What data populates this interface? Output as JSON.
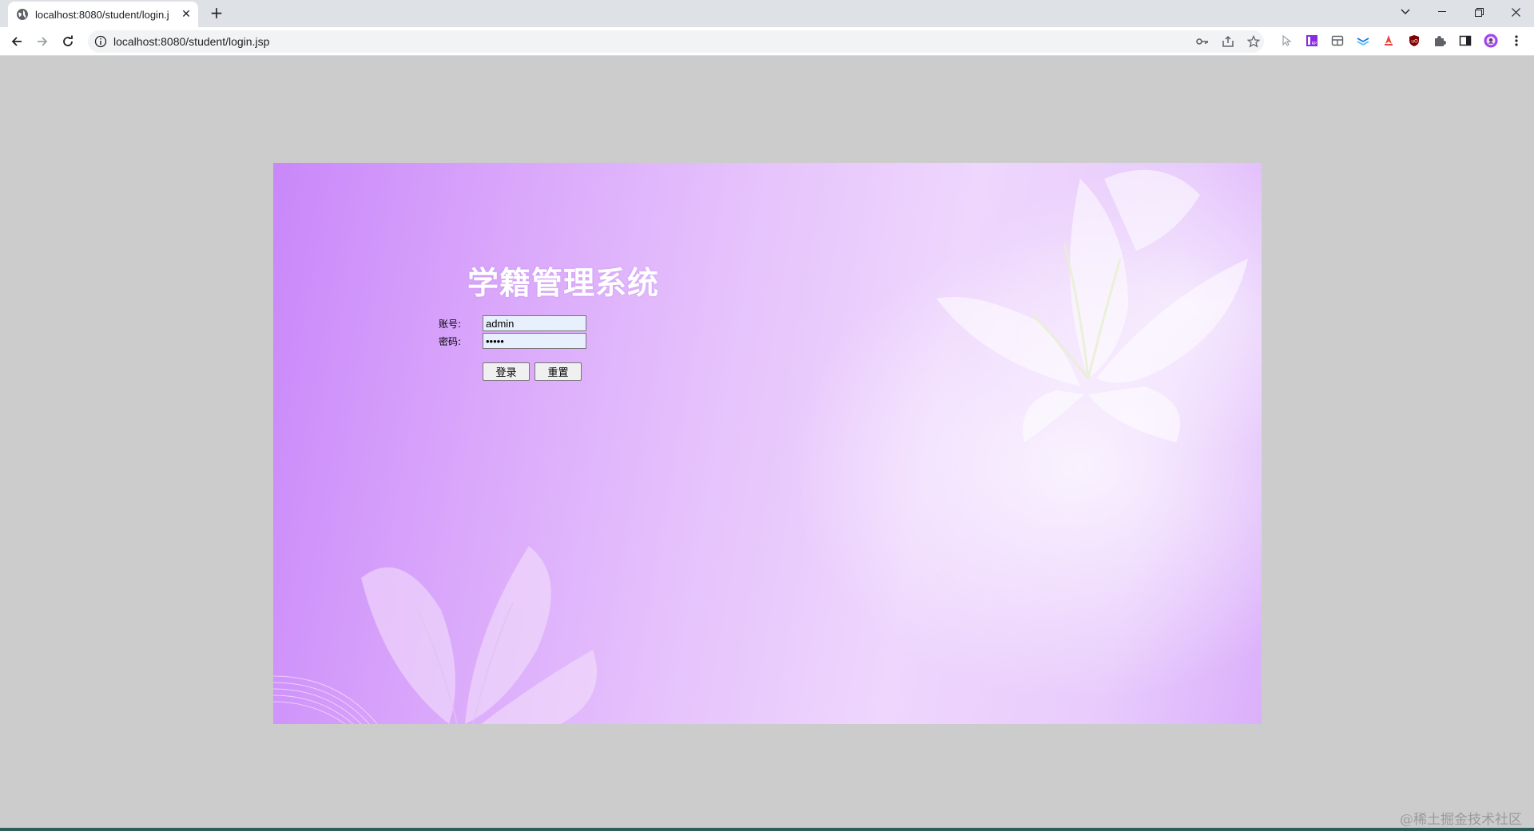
{
  "browser": {
    "tab": {
      "title": "localhost:8080/student/login.j",
      "close_glyph": "✕"
    },
    "new_tab_glyph": "+",
    "address_bar": {
      "url": "localhost:8080/student/login.jsp"
    },
    "window_controls": {
      "dropdown": "⌄",
      "minimize": "—",
      "restore": "❐",
      "close": "✕"
    },
    "extensions": [
      "cursor-extension-icon",
      "rp-extension-icon",
      "grid-extension-icon",
      "layers-extension-icon",
      "flame-extension-icon",
      "ublock-icon",
      "puzzle-icon",
      "sidepanel-icon",
      "profile-avatar",
      "more-menu-icon"
    ]
  },
  "login": {
    "title": "学籍管理系统",
    "account_label": "账号:",
    "account_value": "admin",
    "password_label": "密码:",
    "password_value": "•••••",
    "login_button": "登录",
    "reset_button": "重置"
  },
  "watermark": "@稀土掘金技术社区",
  "colors": {
    "page_background": "#cccccc",
    "panel_left": "#c987f9",
    "panel_right": "#eed6fd",
    "input_background": "#e8f0fe"
  }
}
